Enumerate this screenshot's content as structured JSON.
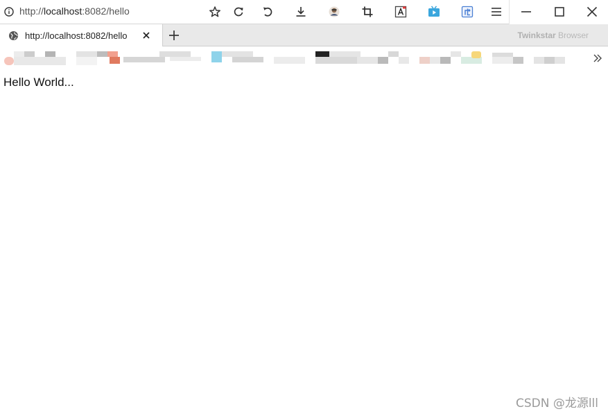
{
  "address_bar": {
    "url_prefix": "http://",
    "url_host": "localhost",
    "url_rest": ":8082/hello"
  },
  "toolbar_icons": [
    "star-icon",
    "refresh-icon",
    "undo-icon",
    "download-icon",
    "avatar-icon",
    "crop-icon",
    "translate-icon",
    "tv-icon",
    "puzzle-icon",
    "menu-icon"
  ],
  "window_controls": [
    "minimize-icon",
    "maximize-icon",
    "close-icon"
  ],
  "tab": {
    "title": "http://localhost:8082/hello"
  },
  "brand": {
    "bold": "Twinkstar",
    "light": " Browser"
  },
  "page": {
    "body_text": "Hello World..."
  },
  "watermark": "CSDN @龙源lll",
  "colors": {
    "toolbar_bg": "#ffffff",
    "tabstrip_bg": "#e9e9e9",
    "active_tab_bg": "#ffffff",
    "tv_icon": "#3aa6dd",
    "puzzle_icon": "#4a7fd4",
    "translate_icon_accent": "#e23b3b"
  }
}
